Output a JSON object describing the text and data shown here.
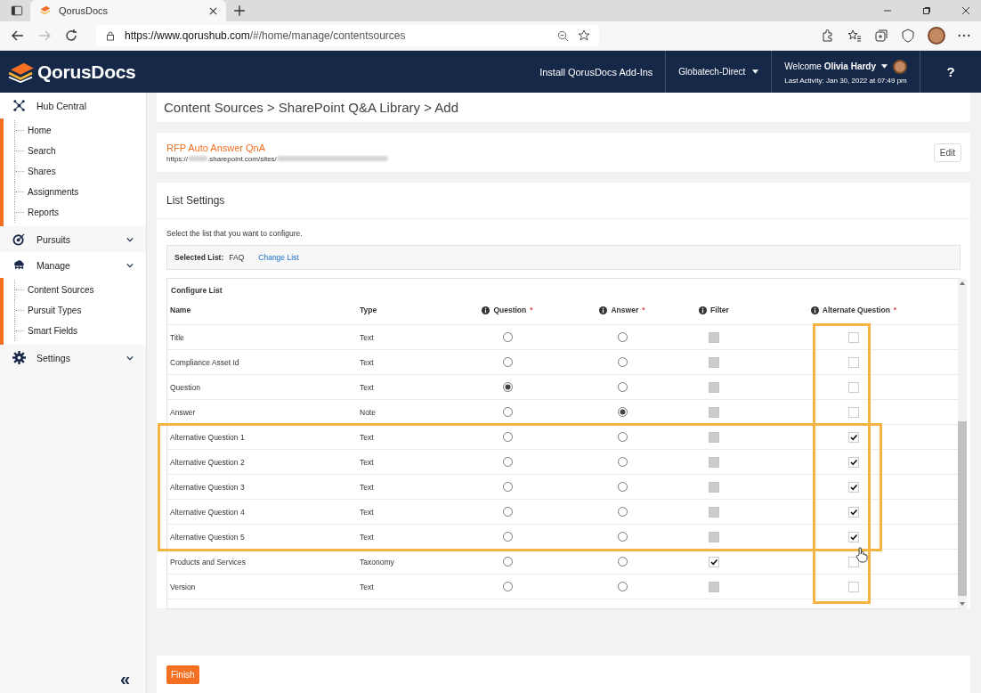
{
  "browser": {
    "tab_title": "QorusDocs",
    "url_host": "https://www.qorushub.com",
    "url_path": "/#/home/manage/contentsources"
  },
  "header": {
    "logo": "QorusDocs",
    "install_link": "Install QorusDocs Add-Ins",
    "org": "Globatech-Direct",
    "welcome": "Welcome",
    "user": "Olivia Hardy",
    "last_activity": "Last Activity: Jan 30, 2022 at 07:49 pm",
    "help": "?"
  },
  "sidebar": {
    "sections": [
      {
        "label": "Hub Central",
        "kind": "hub",
        "collapsible": false,
        "children": [
          "Home",
          "Search",
          "Shares",
          "Assignments",
          "Reports"
        ]
      },
      {
        "label": "Pursuits",
        "kind": "target",
        "collapsible": true
      },
      {
        "label": "Manage",
        "kind": "cloud",
        "collapsible": true,
        "children": [
          "Content Sources",
          "Pursuit Types",
          "Smart Fields"
        ]
      },
      {
        "label": "Settings",
        "kind": "gear",
        "collapsible": true
      }
    ],
    "collapse": "«"
  },
  "breadcrumb": "Content Sources > SharePoint Q&A Library > Add",
  "source": {
    "title": "RFP Auto Answer QnA",
    "url_segments": [
      {
        "kind": "text",
        "text": "https://"
      },
      {
        "kind": "redacted_short"
      },
      {
        "kind": "text",
        "text": ".sharepoint.com/sites/"
      },
      {
        "kind": "redacted_long"
      }
    ],
    "edit": "Edit"
  },
  "list_settings": {
    "title": "List Settings",
    "instruction": "Select the list that you want to configure.",
    "selected_label": "Selected List:",
    "selected_value": "FAQ",
    "change": "Change List"
  },
  "configure": {
    "title": "Configure List",
    "columns": [
      {
        "label": "Name",
        "info": false
      },
      {
        "label": "Type",
        "info": false
      },
      {
        "label": "Question",
        "info": true,
        "marker": "*"
      },
      {
        "label": "Answer",
        "info": true,
        "marker": "*"
      },
      {
        "label": "Filter",
        "info": true
      },
      {
        "label": "Alternate Question",
        "info": true,
        "marker": "*"
      }
    ],
    "rows": [
      {
        "name": "Title",
        "type": "Text",
        "question": false,
        "answer": false,
        "filter": {
          "checked": false,
          "disabled": true
        },
        "alternate": false
      },
      {
        "name": "Compliance Asset Id",
        "type": "Text",
        "question": false,
        "answer": false,
        "filter": {
          "checked": false,
          "disabled": true
        },
        "alternate": false
      },
      {
        "name": "Question",
        "type": "Text",
        "question": true,
        "answer": false,
        "filter": {
          "checked": false,
          "disabled": true
        },
        "alternate": false
      },
      {
        "name": "Answer",
        "type": "Note",
        "question": false,
        "answer": true,
        "filter": {
          "checked": false,
          "disabled": true
        },
        "alternate": false
      },
      {
        "name": "Alternative Question 1",
        "type": "Text",
        "question": false,
        "answer": false,
        "filter": {
          "checked": false,
          "disabled": true
        },
        "alternate": true
      },
      {
        "name": "Alternative Question 2",
        "type": "Text",
        "question": false,
        "answer": false,
        "filter": {
          "checked": false,
          "disabled": true
        },
        "alternate": true
      },
      {
        "name": "Alternative Question 3",
        "type": "Text",
        "question": false,
        "answer": false,
        "filter": {
          "checked": false,
          "disabled": true
        },
        "alternate": true
      },
      {
        "name": "Alternative Question 4",
        "type": "Text",
        "question": false,
        "answer": false,
        "filter": {
          "checked": false,
          "disabled": true
        },
        "alternate": true
      },
      {
        "name": "Alternative Question 5",
        "type": "Text",
        "question": false,
        "answer": false,
        "filter": {
          "checked": false,
          "disabled": true
        },
        "alternate": true
      },
      {
        "name": "Products and Services",
        "type": "Taxonomy",
        "question": false,
        "answer": false,
        "filter": {
          "checked": true,
          "disabled": false
        },
        "alternate": false
      },
      {
        "name": "Version",
        "type": "Text",
        "question": false,
        "answer": false,
        "filter": {
          "checked": false,
          "disabled": true
        },
        "alternate": false
      }
    ]
  },
  "finish": "Finish"
}
